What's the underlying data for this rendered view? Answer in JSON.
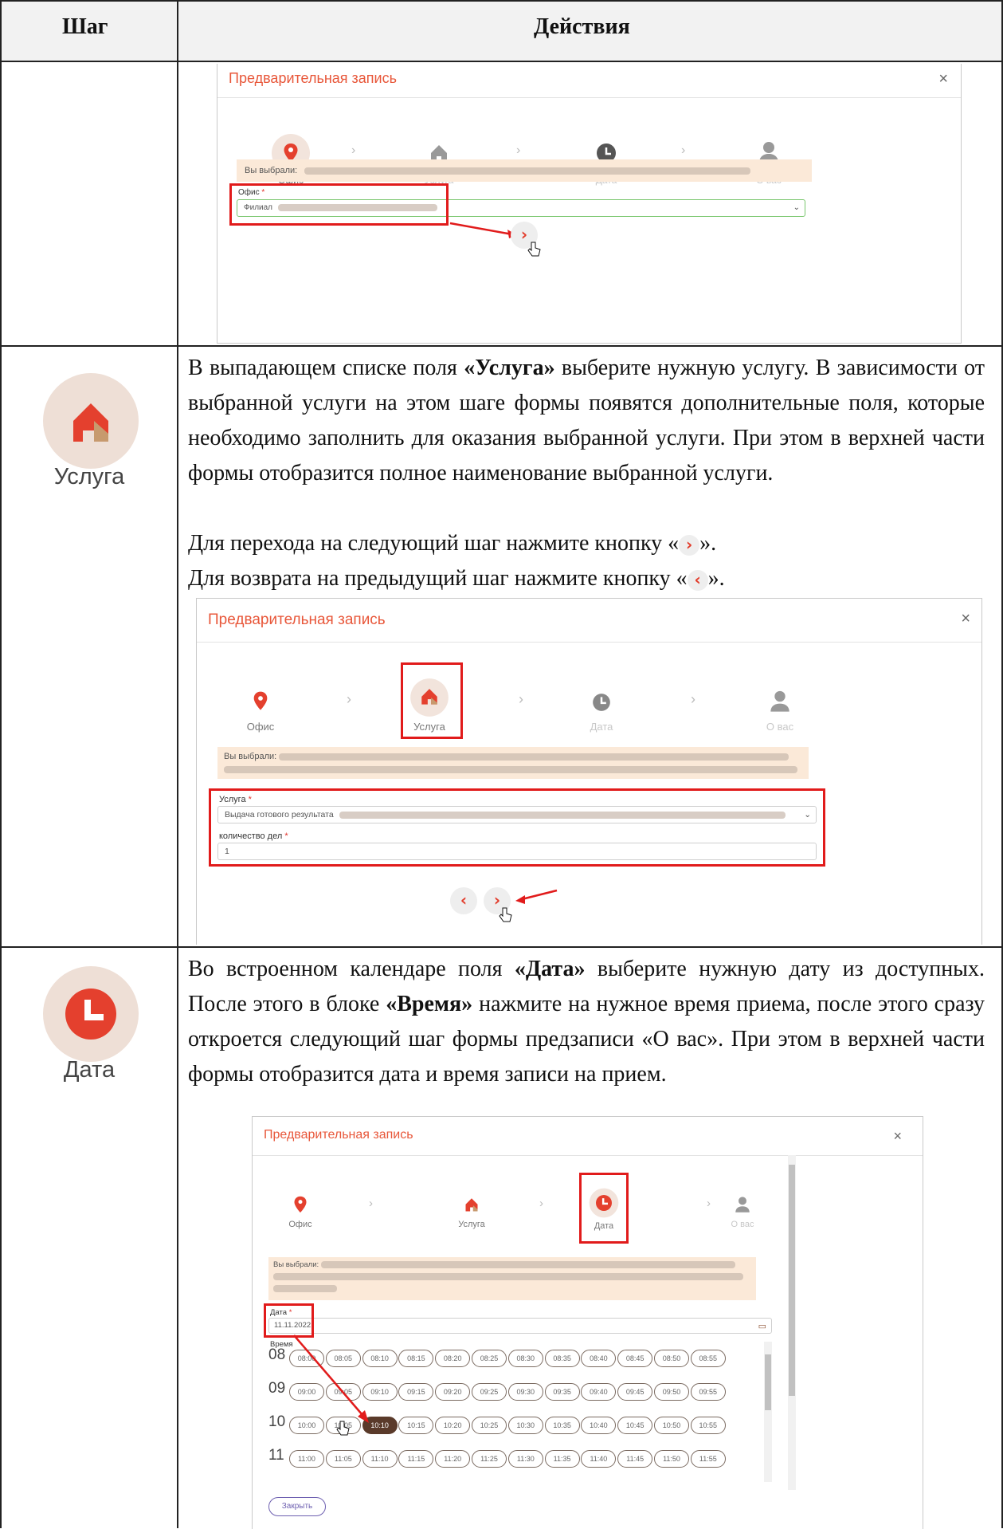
{
  "table": {
    "header_step": "Шаг",
    "header_actions": "Действия"
  },
  "form": {
    "title": "Предварительная запись",
    "close_glyph": "×",
    "selected_label": "Вы выбрали:",
    "steps": [
      "Офис",
      "Услуга",
      "Дата",
      "О вас"
    ],
    "office_field_label": "Офис",
    "office_value": "Филиал",
    "service_field_label": "Услуга",
    "service_value": "Выдача готового результата",
    "count_field_label": "количество дел",
    "count_value": "1",
    "date_field_label": "Дата",
    "date_value": "11.11.2022",
    "time_label": "Время",
    "close_button": "Закрыть",
    "required_mark": "*"
  },
  "rows": [
    {
      "step_label": "Услуга",
      "icon": "house-icon",
      "para_line1_a": "В выпадающем списке поля ",
      "para_line1_b": "«Услуга»",
      "para_line1_c": " выберите нужную услугу. В зависимости от выбранной услуги на этом шаге формы появятся дополнительные поля, которые необходимо заполнить для оказания выбранной услуги. При этом в верхней части формы отобразится полное наименование выбранной услуги.",
      "next_line_a": "Для перехода на следующий шаг нажмите кнопку «",
      "next_line_b": "».",
      "prev_line_a": "Для возврата на предыдущий шаг нажмите кнопку «",
      "prev_line_b": "»."
    },
    {
      "step_label": "Дата",
      "icon": "clock-icon",
      "para_a": "Во встроенном календаре поля ",
      "para_b": "«Дата»",
      "para_c": " выберите нужную дату из доступных. После этого в блоке ",
      "para_d": "«Время»",
      "para_e": " нажмите на нужное время приема, после этого сразу откроется следующий шаг формы предзаписи «О вас». При этом в верхней части формы отобразится дата и время записи на прием."
    }
  ],
  "time_slots": {
    "hours": [
      "08",
      "09",
      "10",
      "11"
    ],
    "rows": [
      [
        "08:00",
        "08:05",
        "08:10",
        "08:15",
        "08:20",
        "08:25",
        "08:30",
        "08:35",
        "08:40",
        "08:45",
        "08:50",
        "08:55"
      ],
      [
        "09:00",
        "09:05",
        "09:10",
        "09:15",
        "09:20",
        "09:25",
        "09:30",
        "09:35",
        "09:40",
        "09:45",
        "09:50",
        "09:55"
      ],
      [
        "10:00",
        "10:05",
        "10:10",
        "10:15",
        "10:20",
        "10:25",
        "10:30",
        "10:35",
        "10:40",
        "10:45",
        "10:50",
        "10:55"
      ],
      [
        "11:00",
        "11:05",
        "11:10",
        "11:15",
        "11:20",
        "11:25",
        "11:30",
        "11:35",
        "11:40",
        "11:45",
        "11:50",
        "11:55"
      ]
    ],
    "selected": "10:10"
  },
  "colors": {
    "accent": "#e8573a",
    "highlight": "#e11b1b",
    "selected_bg": "#fbe9d8"
  }
}
